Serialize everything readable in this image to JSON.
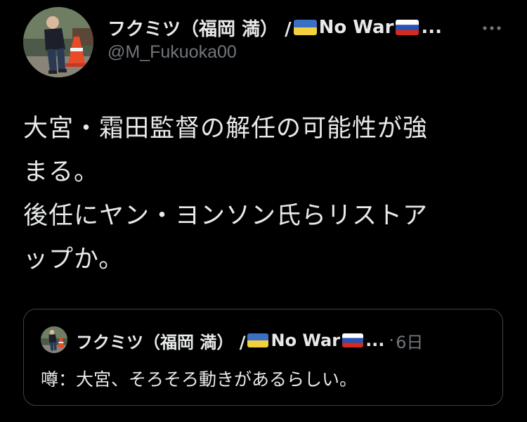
{
  "tweet": {
    "author": {
      "name_prefix": "フクミツ（福岡 満） / ",
      "name_mid": "No War",
      "name_suffix": "...",
      "handle": "@M_Fukuoka00",
      "avatar_icon": "profile-photo-person-with-traffic-cone"
    },
    "more_icon": "more-horizontal-icon",
    "body_lines": [
      "大宮・霜田監督の解任の可能性が強",
      "まる。",
      "後任にヤン・ヨンソン氏らリストア",
      "ップか。"
    ],
    "quote": {
      "name_prefix": "フクミツ（福岡 満） / ",
      "name_mid": "No War",
      "name_suffix": "...",
      "dot": "·",
      "time": "6日",
      "text": "噂：大宮、そろそろ動きがあるらしい。"
    },
    "flags": {
      "ukraine": [
        "#3b6fc4",
        "#f4d03f"
      ],
      "russia": [
        "#ffffff",
        "#2553b8",
        "#d52b1e"
      ]
    }
  }
}
